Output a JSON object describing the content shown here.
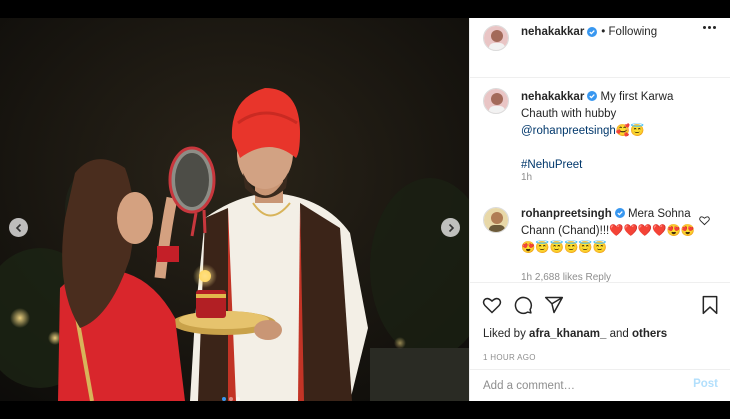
{
  "post": {
    "author": "nehakakkar",
    "follow_status": "• Following",
    "caption_text": "My first Karwa Chauth with hubby",
    "caption_mention": "@rohanpreetsingh",
    "caption_emoji": "🥰😇",
    "hashtag": "#NehuPreet",
    "caption_time": "1h",
    "likes_prefix": "Liked by",
    "liked_by": "afra_khanam_",
    "likes_and": "and",
    "likes_others": "others",
    "posted_ago": "1 HOUR AGO"
  },
  "comments": [
    {
      "user": "rohanpreetsingh",
      "text": "Mera Sohna Chann (Chand)!!!❤️❤️❤️❤️😍😍😍😇😇😇😇😇",
      "meta": "1h   2,688 likes   Reply"
    }
  ],
  "add_comment": {
    "placeholder": "Add a comment…",
    "post_label": "Post"
  },
  "colors": {
    "verified": "#3897f0",
    "link": "#00376b",
    "post_button": "#b2dffc",
    "turban": "#e8352b",
    "dupatta": "#d9262c"
  },
  "icons": [
    "chevron-left-icon",
    "chevron-right-icon",
    "verified-badge-icon",
    "more-options-icon",
    "heart-icon",
    "comment-icon",
    "share-icon",
    "bookmark-icon"
  ]
}
